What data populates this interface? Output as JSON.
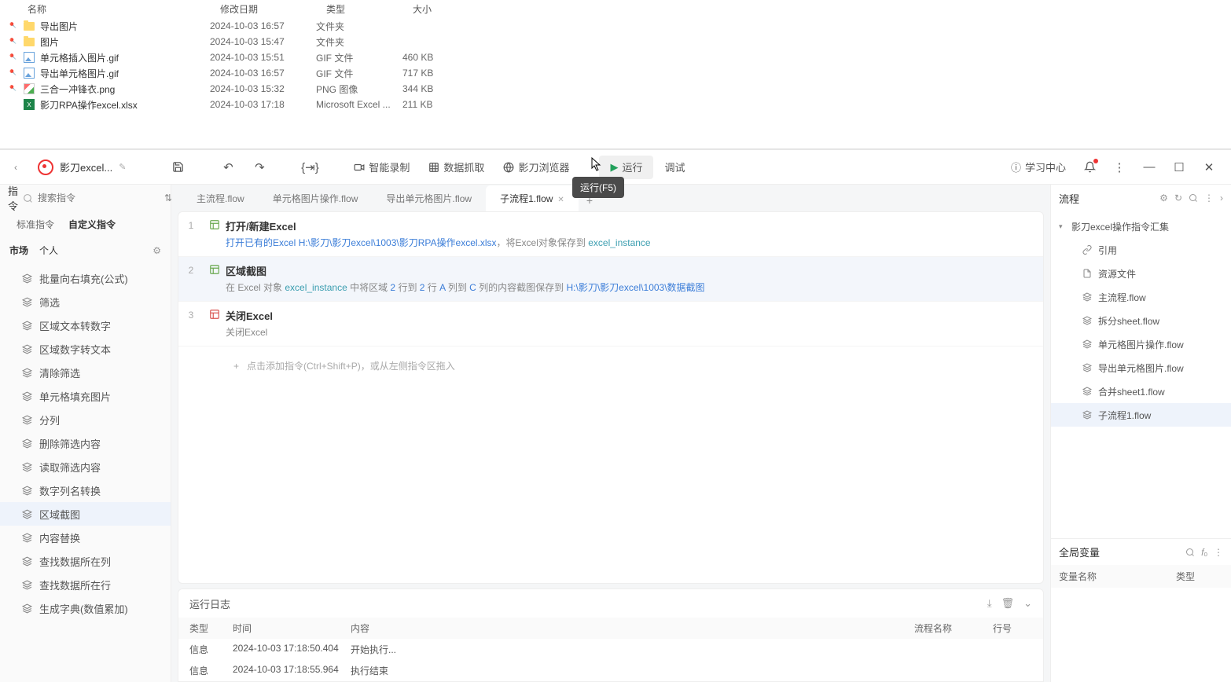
{
  "file_explorer": {
    "headers": {
      "name": "名称",
      "date": "修改日期",
      "type": "类型",
      "size": "大小"
    },
    "rows": [
      {
        "name": "导出图片",
        "date": "2024-10-03 16:57",
        "type": "文件夹",
        "size": "",
        "icon": "folder",
        "pinned": true
      },
      {
        "name": "图片",
        "date": "2024-10-03 15:47",
        "type": "文件夹",
        "size": "",
        "icon": "folder",
        "pinned": true
      },
      {
        "name": "单元格插入图片.gif",
        "date": "2024-10-03 15:51",
        "type": "GIF 文件",
        "size": "460 KB",
        "icon": "img",
        "pinned": true
      },
      {
        "name": "导出单元格图片.gif",
        "date": "2024-10-03 16:57",
        "type": "GIF 文件",
        "size": "717 KB",
        "icon": "img",
        "pinned": true
      },
      {
        "name": "三合一冲锋衣.png",
        "date": "2024-10-03 15:32",
        "type": "PNG 图像",
        "size": "344 KB",
        "icon": "png",
        "pinned": true
      },
      {
        "name": "影刀RPA操作excel.xlsx",
        "date": "2024-10-03 17:18",
        "type": "Microsoft Excel ...",
        "size": "211 KB",
        "icon": "xlsx",
        "pinned": false
      }
    ]
  },
  "toolbar": {
    "app_title": "影刀excel...",
    "smart_record": "智能录制",
    "data_grab": "数据抓取",
    "browser": "影刀浏览器",
    "run": "运行",
    "debug": "调试",
    "learn": "学习中心",
    "tooltip": "运行(F5)"
  },
  "sidebar": {
    "title": "指令",
    "search_placeholder": "搜索指令",
    "tabs": {
      "standard": "标准指令",
      "custom": "自定义指令"
    },
    "sub": {
      "market": "市场",
      "personal": "个人"
    },
    "items": [
      "批量向右填充(公式)",
      "筛选",
      "区域文本转数字",
      "区域数字转文本",
      "清除筛选",
      "单元格填充图片",
      "分列",
      "删除筛选内容",
      "读取筛选内容",
      "数字列名转换",
      "区域截图",
      "内容替换",
      "查找数据所在列",
      "查找数据所在行",
      "生成字典(数值累加)"
    ],
    "selected_index": 10
  },
  "tabs": [
    {
      "label": "主流程.flow",
      "active": false
    },
    {
      "label": "单元格图片操作.flow",
      "active": false
    },
    {
      "label": "导出单元格图片.flow",
      "active": false
    },
    {
      "label": "子流程1.flow",
      "active": true
    }
  ],
  "steps": [
    {
      "num": "1",
      "title": "打开/新建Excel",
      "icon_color": "green",
      "parts": [
        {
          "t": "打开已有的Excel ",
          "c": "blue"
        },
        {
          "t": "H:\\影刀\\影刀excel\\1003\\影刀RPA操作excel.xlsx",
          "c": "blue"
        },
        {
          "t": "，将Excel对象保存到 ",
          "c": ""
        },
        {
          "t": "excel_instance",
          "c": "teal"
        }
      ]
    },
    {
      "num": "2",
      "title": "区域截图",
      "icon_color": "grey",
      "selected": true,
      "parts": [
        {
          "t": "在 Excel 对象 ",
          "c": ""
        },
        {
          "t": "excel_instance",
          "c": "teal"
        },
        {
          "t": " 中将区域 ",
          "c": ""
        },
        {
          "t": "2",
          "c": "blue"
        },
        {
          "t": " 行到 ",
          "c": ""
        },
        {
          "t": "2",
          "c": "blue"
        },
        {
          "t": " 行 ",
          "c": ""
        },
        {
          "t": "A",
          "c": "blue"
        },
        {
          "t": " 列到 ",
          "c": ""
        },
        {
          "t": "C",
          "c": "blue"
        },
        {
          "t": " 列的内容截图保存到 ",
          "c": ""
        },
        {
          "t": "H:\\影刀\\影刀excel\\1003\\数据截图",
          "c": "blue"
        }
      ]
    },
    {
      "num": "3",
      "title": "关闭Excel",
      "icon_color": "red",
      "parts": [
        {
          "t": "关闭Excel",
          "c": ""
        }
      ]
    }
  ],
  "add_step_hint": "点击添加指令(Ctrl+Shift+P)，或从左侧指令区拖入",
  "log": {
    "title": "运行日志",
    "headers": {
      "type": "类型",
      "time": "时间",
      "content": "内容",
      "flow": "流程名称",
      "line": "行号"
    },
    "rows": [
      {
        "type": "信息",
        "time": "2024-10-03 17:18:50.404",
        "content": "开始执行...",
        "flow": "",
        "line": ""
      },
      {
        "type": "信息",
        "time": "2024-10-03 17:18:55.964",
        "content": "执行结束",
        "flow": "",
        "line": ""
      }
    ]
  },
  "right": {
    "title": "流程",
    "root": "影刀excel操作指令汇集",
    "items": [
      {
        "label": "引用",
        "icon": "link"
      },
      {
        "label": "资源文件",
        "icon": "file"
      },
      {
        "label": "主流程.flow",
        "icon": "layers"
      },
      {
        "label": "拆分sheet.flow",
        "icon": "layers"
      },
      {
        "label": "单元格图片操作.flow",
        "icon": "layers"
      },
      {
        "label": "导出单元格图片.flow",
        "icon": "layers"
      },
      {
        "label": "合并sheet1.flow",
        "icon": "layers"
      },
      {
        "label": "子流程1.flow",
        "icon": "layers",
        "selected": true
      }
    ],
    "globals": {
      "title": "全局变量",
      "headers": {
        "name": "变量名称",
        "type": "类型"
      }
    }
  }
}
